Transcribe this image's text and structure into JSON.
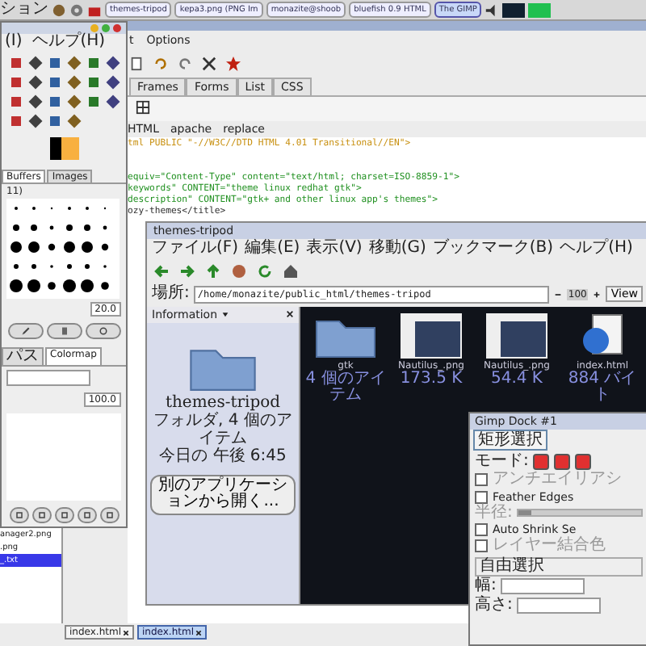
{
  "panel": {
    "menu_label": "ション",
    "tasks": [
      {
        "label": "themes-tripod",
        "selected": false
      },
      {
        "label": "kepa3.png (PNG Im",
        "selected": false
      },
      {
        "label": "monazite@shoob",
        "selected": false
      },
      {
        "label": "bluefish 0.9 HTML",
        "selected": false
      },
      {
        "label": "The GIMP",
        "selected": true
      }
    ]
  },
  "editor": {
    "menu": [
      "t",
      "Options"
    ],
    "tabs": [
      "Frames",
      "Forms",
      "List",
      "CSS"
    ],
    "subtabs": [
      "HTML",
      "apache",
      "replace"
    ],
    "code_lines": [
      {
        "kind": "doctype",
        "text": "tml PUBLIC \"-//W3C//DTD HTML 4.01 Transitional//EN\">"
      },
      {
        "kind": "meta",
        "text": "equiv=\"Content-Type\" content=\"text/html; charset=ISO-8859-1\">"
      },
      {
        "kind": "meta",
        "text": "keywords\" CONTENT=\"theme linux redhat gtk\">"
      },
      {
        "kind": "meta",
        "text": "description\" CONTENT=\"gtk+ and other linux app's themes\">"
      },
      {
        "kind": "plain",
        "text": "ozy-themes</title>"
      }
    ],
    "files": [
      {
        "name": "anager2.png",
        "selected": false
      },
      {
        "name": ".png",
        "selected": false
      },
      {
        "name": "_.txt",
        "selected": true
      }
    ],
    "doc_tabs": [
      {
        "label": "index.html",
        "selected": false
      },
      {
        "label": "index.html",
        "selected": true
      }
    ]
  },
  "toolbox": {
    "menu": [
      "(I)",
      "ヘルプ(H)"
    ],
    "dock_tabs": [
      {
        "label": "Buffers",
        "selected": true
      },
      {
        "label": "Images",
        "selected": false
      }
    ],
    "brush_count": "11)",
    "brush_size": "20.0",
    "lower_tabs": [
      {
        "label": "パス",
        "selected": false
      },
      {
        "label": "Colormap",
        "selected": true
      }
    ],
    "opacity": "100.0"
  },
  "nautilus": {
    "title": "themes-tripod",
    "menu": [
      "ファイル(F)",
      "編集(E)",
      "表示(V)",
      "移動(G)",
      "ブックマーク(B)",
      "ヘルプ(H)"
    ],
    "location_label": "場所:",
    "location": "/home/monazite/public_html/themes-tripod",
    "zoom": "100",
    "view_button": "View",
    "sidebar_title": "Information",
    "folder_name": "themes-tripod",
    "folder_info": "フォルダ, 4 個のアイテム",
    "folder_date": "今日の 午後 6:45",
    "open_button": "別のアプリケーションから開く...",
    "items": [
      {
        "kind": "folder",
        "name": "gtk",
        "info": "4 個のアイテム"
      },
      {
        "kind": "image",
        "name": "Nautilus_.png",
        "info": "173.5 K"
      },
      {
        "kind": "image",
        "name": "Nautilus_.png",
        "info": "54.4 K"
      },
      {
        "kind": "html",
        "name": "index.html",
        "info": "884 バイト"
      }
    ]
  },
  "dock": {
    "title": "Gimp Dock #1",
    "tab": "矩形選択",
    "mode_label": "モード:",
    "options": [
      {
        "label": "アンチエイリアシ",
        "checked": false,
        "disabled": true
      },
      {
        "label": "Feather Edges",
        "checked": false,
        "disabled": false
      },
      {
        "label": "Auto Shrink Se",
        "checked": false,
        "disabled": false
      },
      {
        "label": "レイヤー結合色",
        "checked": false,
        "disabled": true
      }
    ],
    "radius": {
      "label": "半径:",
      "level": 0.1
    },
    "select_mode": "自由選択",
    "width_label": "幅:",
    "height_label": "高さ:"
  }
}
